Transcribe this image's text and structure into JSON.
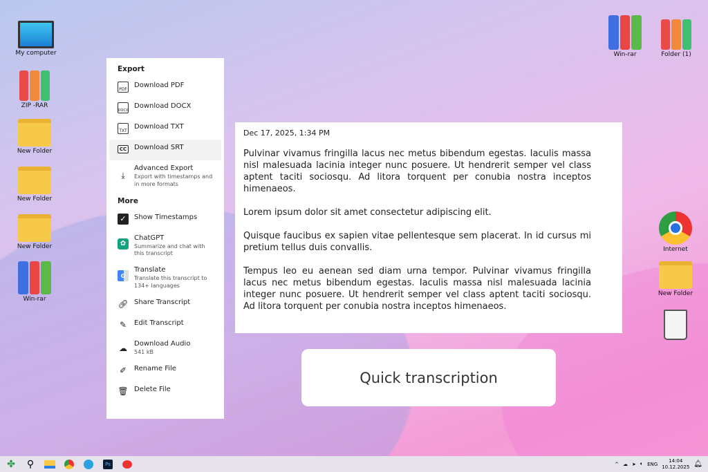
{
  "desktop": {
    "left_icons": [
      "My computer",
      "ZIP -RAR",
      "New Folder",
      "New Folder",
      "New Folder",
      "Win-rar"
    ],
    "right_icons": [
      "Win-rar",
      "Folder (1)",
      "Internet",
      "New Folder"
    ]
  },
  "menu": {
    "export_heading": "Export",
    "more_heading": "More",
    "items": [
      {
        "label": "Download PDF",
        "icon": "pdf-file-icon"
      },
      {
        "label": "Download DOCX",
        "icon": "docx-file-icon"
      },
      {
        "label": "Download TXT",
        "icon": "txt-file-icon"
      },
      {
        "label": "Download SRT",
        "icon": "cc-icon"
      },
      {
        "label": "Advanced Export",
        "sub": "Export with timestamps and in more formats",
        "icon": "download-icon"
      },
      {
        "label": "Show Timestamps",
        "icon": "checkbox-icon",
        "checked": true
      },
      {
        "label": "ChatGPT",
        "sub": "Summarize and chat with this transcript",
        "icon": "chatgpt-icon"
      },
      {
        "label": "Translate",
        "sub": "Translate this transcript to 134+ languages",
        "icon": "translate-icon"
      },
      {
        "label": "Share Transcript",
        "icon": "link-icon"
      },
      {
        "label": "Edit Transcript",
        "icon": "pencil-icon"
      },
      {
        "label": "Download Audio",
        "sub": "541 kB",
        "icon": "cloud-download-icon"
      },
      {
        "label": "Rename File",
        "icon": "edit-icon"
      },
      {
        "label": "Delete File",
        "icon": "trash-icon"
      }
    ],
    "icon_labels": {
      "pdf": "PDF",
      "docx": "DOCX",
      "txt": "TXT",
      "cc": "CC"
    }
  },
  "transcript": {
    "date": "Dec 17, 2025, 1:34 PM",
    "paragraphs": [
      "Pulvinar vivamus fringilla lacus nec metus bibendum egestas. Iaculis massa nisl malesuada lacinia integer nunc posuere. Ut hendrerit semper vel class aptent taciti sociosqu. Ad litora torquent per conubia nostra inceptos himenaeos.",
      "Lorem ipsum dolor sit amet consectetur adipiscing elit.",
      "Quisque faucibus ex sapien vitae pellentesque sem placerat. In id cursus mi pretium tellus duis convallis.",
      "Tempus leo eu aenean sed diam urna tempor. Pulvinar vivamus fringilla lacus nec metus bibendum egestas. Iaculis massa nisl malesuada lacinia integer nunc posuere. Ut hendrerit semper vel class aptent taciti sociosqu. Ad litora torquent per conubia nostra inceptos himenaeos."
    ]
  },
  "banner": {
    "title": "Quick transcription"
  },
  "taskbar": {
    "lang": "ENG",
    "time": "14:04",
    "date": "10.12.2025"
  }
}
